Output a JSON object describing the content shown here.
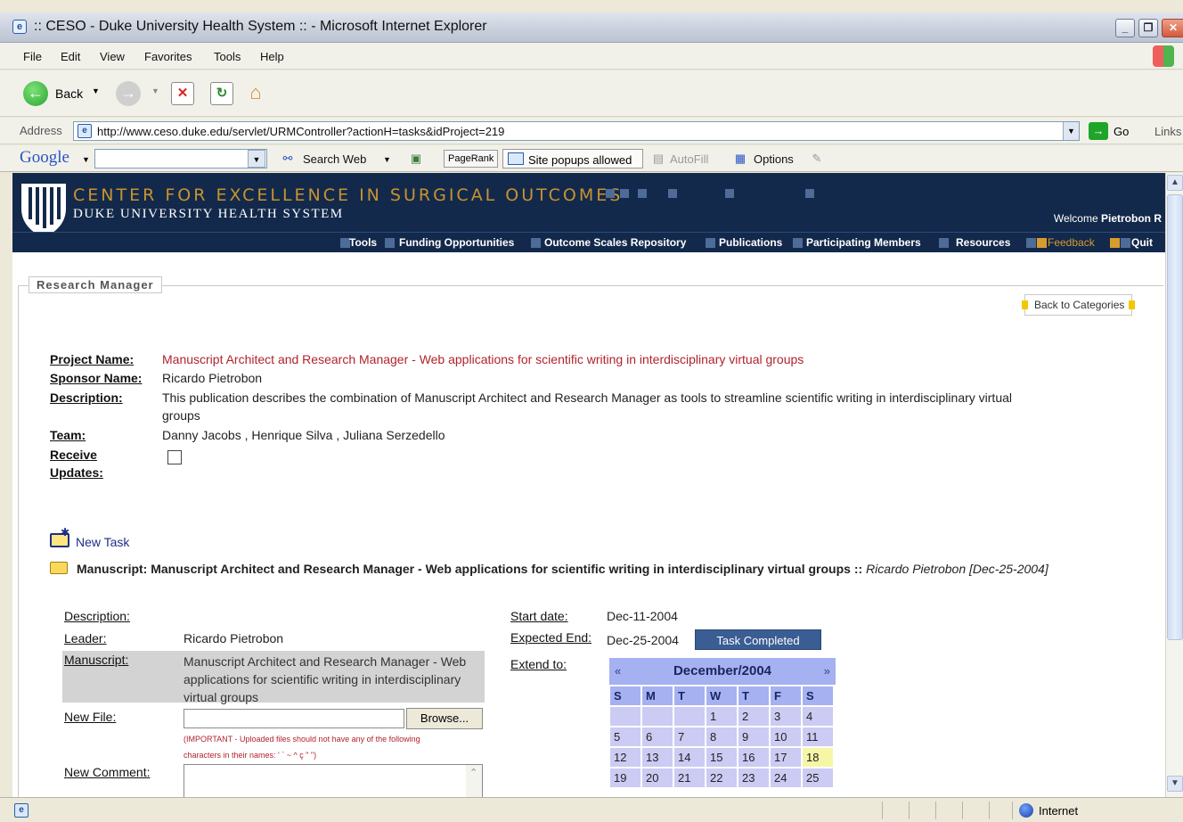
{
  "window": {
    "title": ":: CESO - Duke University Health System :: - Microsoft Internet Explorer",
    "app_icon_glyph": "e"
  },
  "menu": [
    "File",
    "Edit",
    "View",
    "Favorites",
    "Tools",
    "Help"
  ],
  "toolbar": {
    "back_label": "Back"
  },
  "address": {
    "label": "Address",
    "url": "http://www.ceso.duke.edu/servlet/URMController?actionH=tasks&idProject=219",
    "go_label": "Go",
    "links_label": "Links"
  },
  "google_bar": {
    "logo": "Google",
    "search_web": "Search Web",
    "pagerank": "PageRank",
    "popups": "Site popups allowed",
    "autofill": "AutoFill",
    "options": "Options"
  },
  "site": {
    "title": "CENTER FOR EXCELLENCE IN SURGICAL OUTCOMES",
    "subtitle": "DUKE UNIVERSITY HEALTH SYSTEM",
    "welcome_prefix": "Welcome",
    "welcome_user": "Pietrobon R",
    "nav": [
      "Tools",
      "Funding Opportunities",
      "Outcome Scales Repository",
      "Publications",
      "Participating Members",
      "Resources",
      "Feedback",
      "Quit"
    ]
  },
  "research_manager": {
    "legend": "Research Manager",
    "back_to_categories": "Back to Categories"
  },
  "project": {
    "project_name_label": "Project Name:",
    "project_name": "Manuscript Architect and Research Manager - Web applications for scientific writing in interdisciplinary virtual groups",
    "sponsor_name_label": "Sponsor Name:",
    "sponsor_name": "Ricardo Pietrobon",
    "description_label": "Description:",
    "description_line1": "This publication describes the combination of Manuscript Architect and Research Manager as tools to streamline scientific writing in interdisciplinary virtual",
    "description_line2": "groups",
    "team_label": "Team:",
    "team": "Danny Jacobs , Henrique Silva , Juliana Serzedello",
    "receive_label_1": "Receive",
    "receive_label_2": "Updates:"
  },
  "tasks": {
    "new_task": "New Task",
    "manuscript_prefix": "Manuscript: Manuscript Architect and Research Manager - Web applications for scientific writing in interdisciplinary virtual groups ::",
    "manuscript_owner": "Ricardo Pietrobon [Dec-25-2004]"
  },
  "task_detail": {
    "description_label": "Description:",
    "leader_label": "Leader:",
    "leader": "Ricardo Pietrobon",
    "manuscript_label": "Manuscript:",
    "manuscript_value": "Manuscript Architect and Research Manager - Web applications for scientific writing in interdisciplinary virtual groups",
    "new_file_label": "New File:",
    "browse": "Browse...",
    "important_line1": "(IMPORTANT - Uploaded files should not have any of the following",
    "important_line2": "characters in their names: ' ` ~ ^ ç \" \")",
    "new_comment_label": "New Comment:",
    "start_date_label": "Start date:",
    "start_date": "Dec-11-2004",
    "expected_end_label": "Expected End:",
    "expected_end": "Dec-25-2004",
    "task_completed": "Task Completed",
    "extend_to_label": "Extend to:"
  },
  "calendar": {
    "prev": "«",
    "next": "»",
    "title": "December/2004",
    "dow": [
      "S",
      "M",
      "T",
      "W",
      "T",
      "F",
      "S"
    ],
    "weeks": [
      [
        "",
        "",
        "",
        "1",
        "2",
        "3",
        "4"
      ],
      [
        "5",
        "6",
        "7",
        "8",
        "9",
        "10",
        "11"
      ],
      [
        "12",
        "13",
        "14",
        "15",
        "16",
        "17",
        "18"
      ],
      [
        "19",
        "20",
        "21",
        "22",
        "23",
        "24",
        "25"
      ]
    ],
    "highlight_day": "18",
    "colors": {
      "header": "#a6b1f2",
      "cell": "#cbcbf3",
      "today": "#f6f6a6"
    }
  },
  "status": {
    "zone": "Internet"
  },
  "colors": {
    "site_header": "#13294b",
    "site_gold": "#c8932e",
    "project_red": "#b0232c",
    "task_completed": "#3a5d93"
  }
}
